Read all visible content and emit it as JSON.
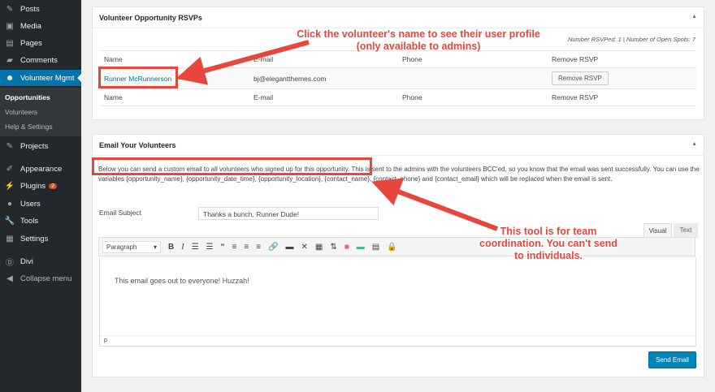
{
  "sidebar": {
    "items": [
      {
        "label": "Posts",
        "icon": "pin-icon"
      },
      {
        "label": "Media",
        "icon": "media-icon"
      },
      {
        "label": "Pages",
        "icon": "pages-icon"
      },
      {
        "label": "Comments",
        "icon": "comment-icon"
      },
      {
        "label": "Volunteer Mgmt",
        "icon": "people-icon"
      },
      {
        "label": "Projects",
        "icon": "pin-icon"
      },
      {
        "label": "Appearance",
        "icon": "brush-icon"
      },
      {
        "label": "Plugins",
        "icon": "plug-icon",
        "badge": "2"
      },
      {
        "label": "Users",
        "icon": "user-icon"
      },
      {
        "label": "Tools",
        "icon": "wrench-icon"
      },
      {
        "label": "Settings",
        "icon": "settings-icon"
      },
      {
        "label": "Divi",
        "icon": "divi-icon"
      },
      {
        "label": "Collapse menu",
        "icon": "collapse-icon"
      }
    ],
    "sub": [
      "Opportunities",
      "Volunteers",
      "Help & Settings"
    ]
  },
  "rsvp": {
    "title": "Volunteer Opportunity RSVPs",
    "summary": "Number RSVPed: 1 | Number of Open Spots: 7",
    "headers": [
      "Name",
      "E-mail",
      "Phone",
      "Remove RSVP"
    ],
    "row": {
      "name": "Runner McRunnerson",
      "email": "bj@elegantthemes.com",
      "phone": "",
      "button": "Remove RSVP"
    }
  },
  "email": {
    "title": "Email Your Volunteers",
    "desc1": "Below you can send a custom email to all volunteers who signed up for this opportunity.",
    "desc2": " This is sent to the admins with the volunteers BCC'ed, so you know that the email was sent successfully. You can use the variables {opportunity_name}, {opportunity_date_time}, {opportunity_location}, {contact_name}, {contact_phone} and {contact_email} which will be replaced when the email is sent.",
    "subject_label": "Email Subject",
    "subject_value": "Thanks a bunch, Runner Dude!",
    "tab_visual": "Visual",
    "tab_text": "Text",
    "format": "Paragraph",
    "body": "This email goes out to everyone! Huzzah!",
    "path": "p",
    "send": "Send Email"
  },
  "callouts": {
    "one": "Click the volunteer's name to see their user profile (only available to admins)",
    "two": "This tool is for team coordination. You can't send to individuals."
  },
  "colors": {
    "accent": "#0073aa",
    "annotation": "#e8453c"
  }
}
